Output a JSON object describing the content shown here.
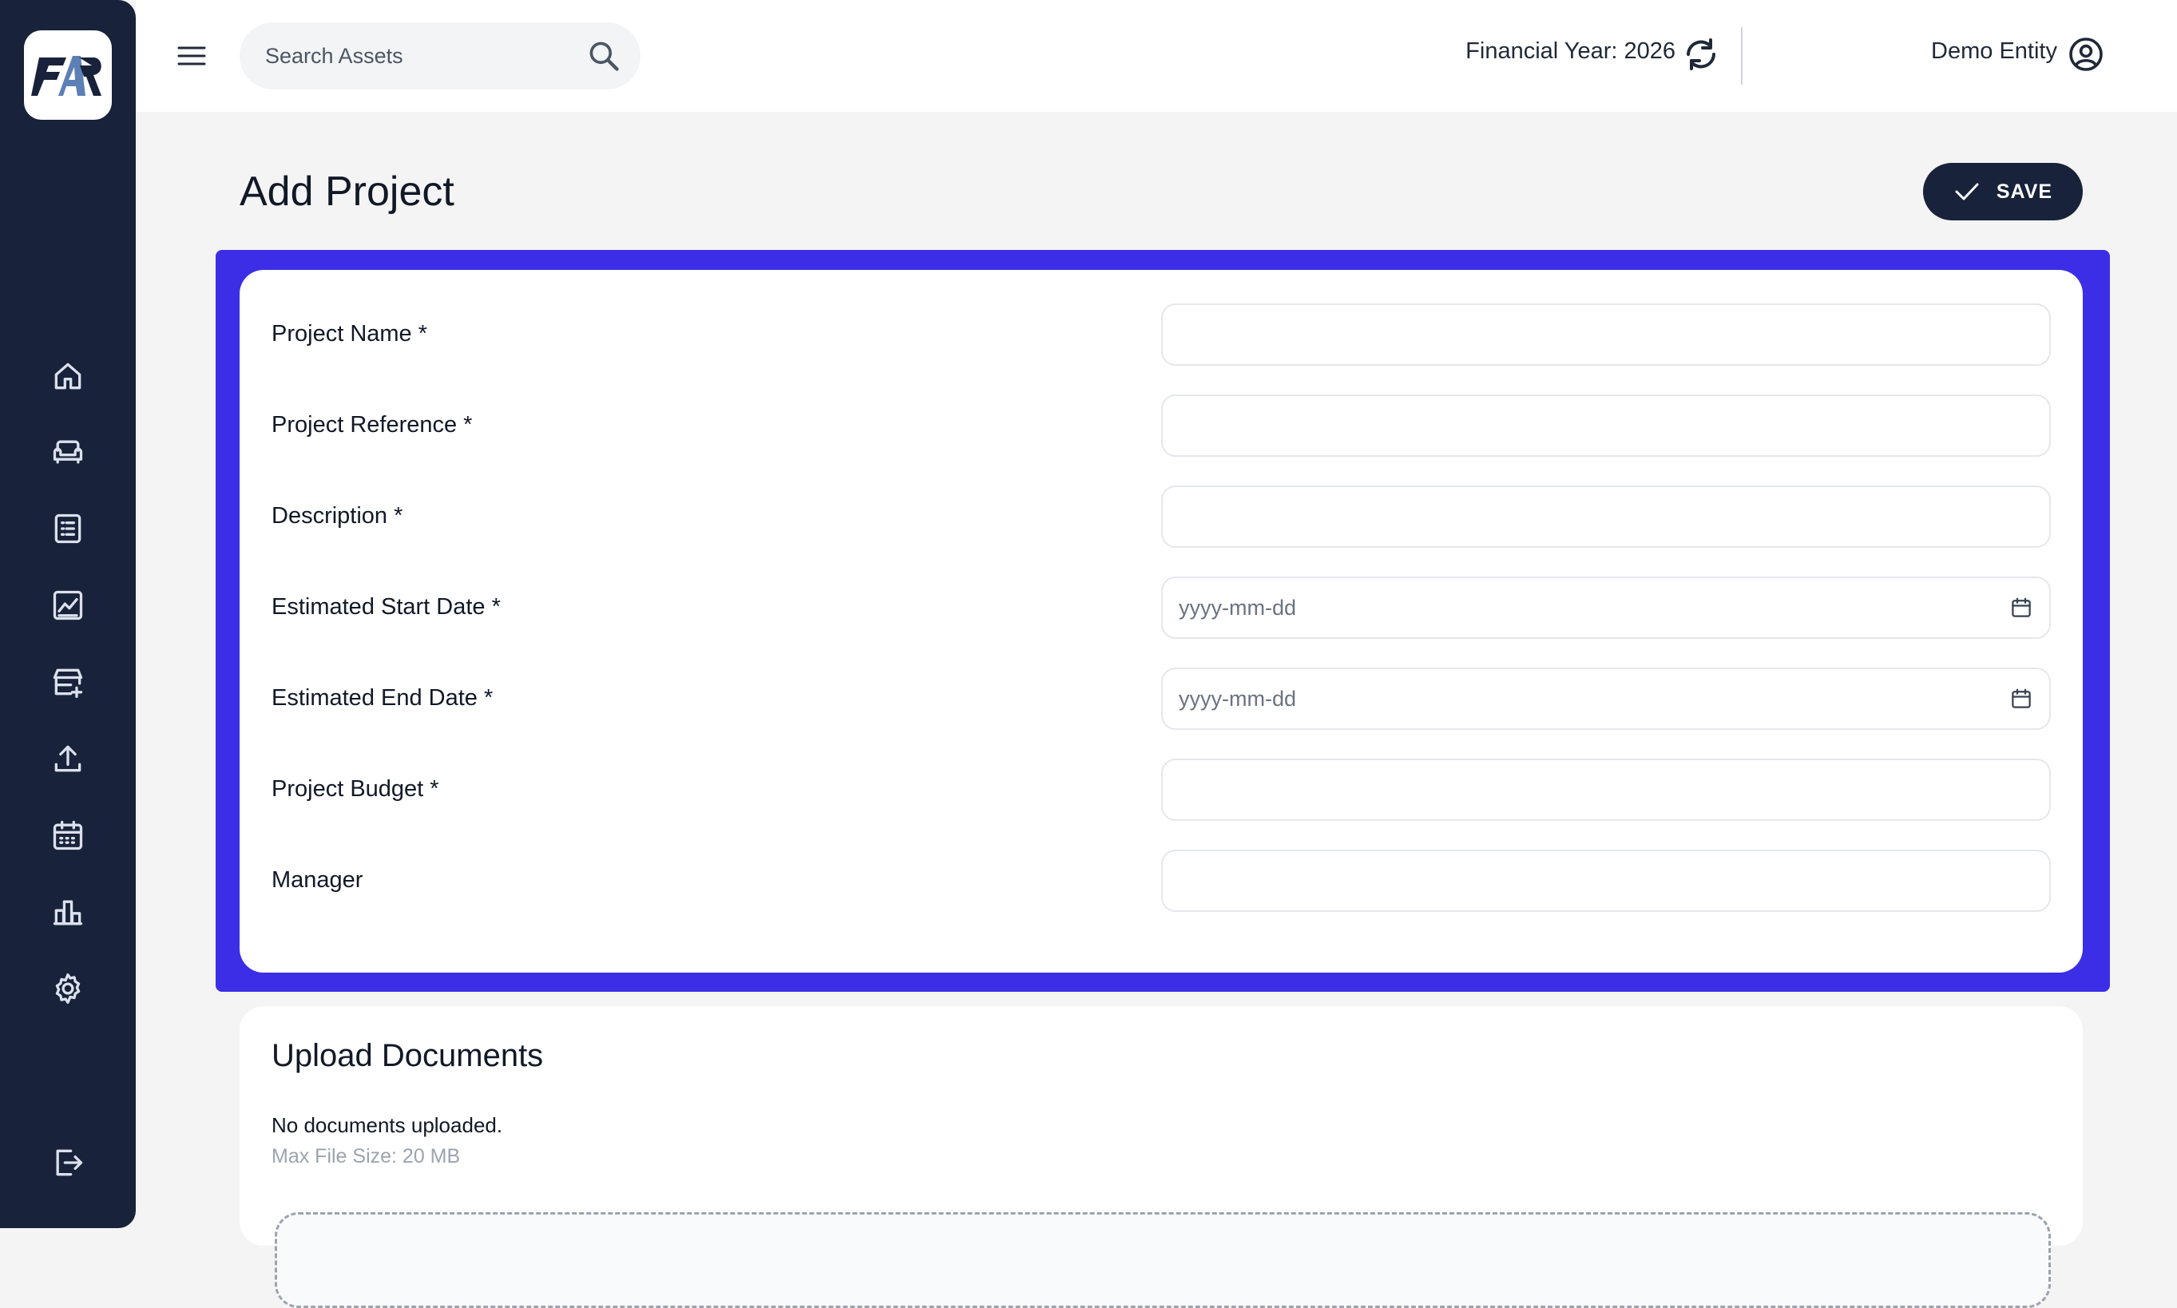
{
  "app": {
    "logo_text": "FAR"
  },
  "sidebar": {
    "items": [
      {
        "icon": "home-icon"
      },
      {
        "icon": "sofa-icon"
      },
      {
        "icon": "list-icon"
      },
      {
        "icon": "chart-line-icon"
      },
      {
        "icon": "store-add-icon"
      },
      {
        "icon": "upload-icon"
      },
      {
        "icon": "calendar-icon"
      },
      {
        "icon": "bar-chart-icon"
      },
      {
        "icon": "gear-icon"
      }
    ],
    "logout_icon": "logout-icon"
  },
  "header": {
    "search_placeholder": "Search Assets",
    "financial_year_label": "Financial Year:",
    "financial_year_value": "2026",
    "entity_name": "Demo Entity"
  },
  "page": {
    "title": "Add Project",
    "save_label": "SAVE"
  },
  "form": {
    "project_name": {
      "label": "Project Name *",
      "value": ""
    },
    "project_reference": {
      "label": "Project Reference *",
      "value": ""
    },
    "description": {
      "label": "Description *",
      "value": ""
    },
    "start_date": {
      "label": "Estimated Start Date *",
      "placeholder": "yyyy-mm-dd"
    },
    "end_date": {
      "label": "Estimated End Date *",
      "placeholder": "yyyy-mm-dd"
    },
    "budget": {
      "label": "Project Budget *",
      "value": ""
    },
    "manager": {
      "label": "Manager",
      "value": ""
    }
  },
  "upload": {
    "title": "Upload Documents",
    "status": "No documents uploaded.",
    "max_size": "Max File Size: 20 MB"
  },
  "colors": {
    "sidebar_bg": "#18223a",
    "highlight": "#3b2ee6",
    "page_bg": "#f4f4f5"
  }
}
